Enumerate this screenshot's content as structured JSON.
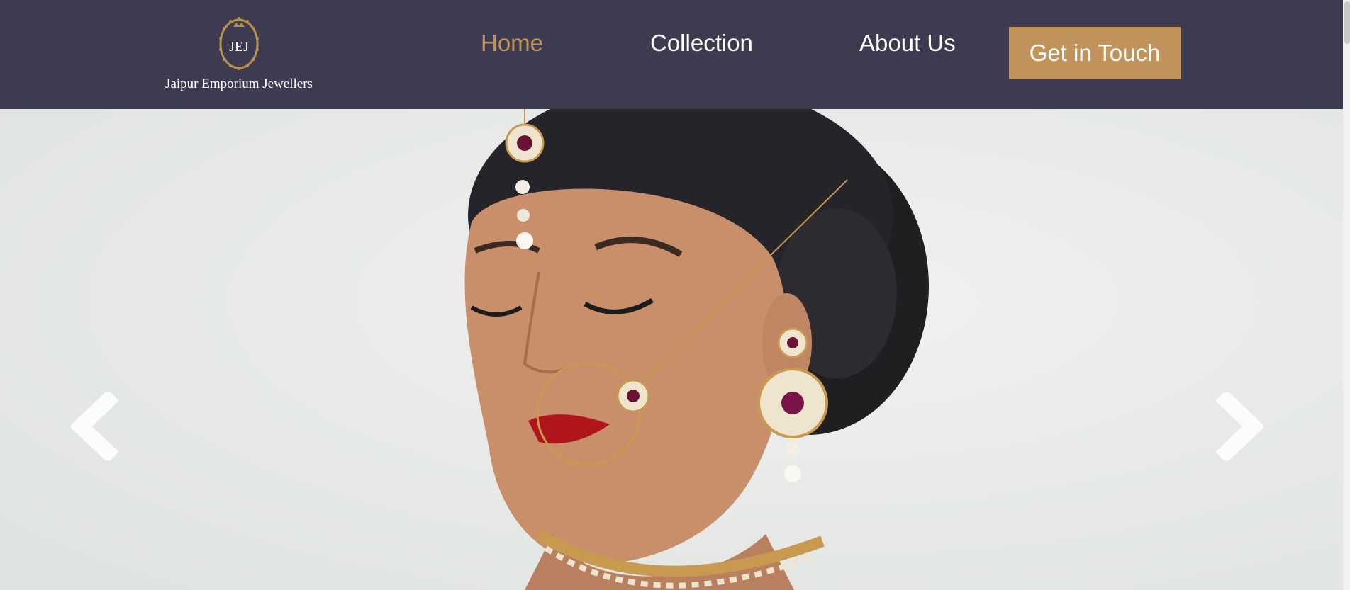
{
  "brand": {
    "monogram": "JEJ",
    "name": "Jaipur Emporium Jewellers"
  },
  "nav": {
    "links": [
      {
        "label": "Home",
        "active": true
      },
      {
        "label": "Collection",
        "active": false
      },
      {
        "label": "About Us",
        "active": false
      }
    ],
    "cta_label": "Get in Touch"
  },
  "hero": {
    "image_subject": "bridal-jewellery-model",
    "prev_icon": "chevron-left-icon",
    "next_icon": "chevron-right-icon"
  },
  "colors": {
    "navbar_bg": "#3d3b50",
    "accent_gold": "#c0935a",
    "text_white": "#ffffff"
  }
}
